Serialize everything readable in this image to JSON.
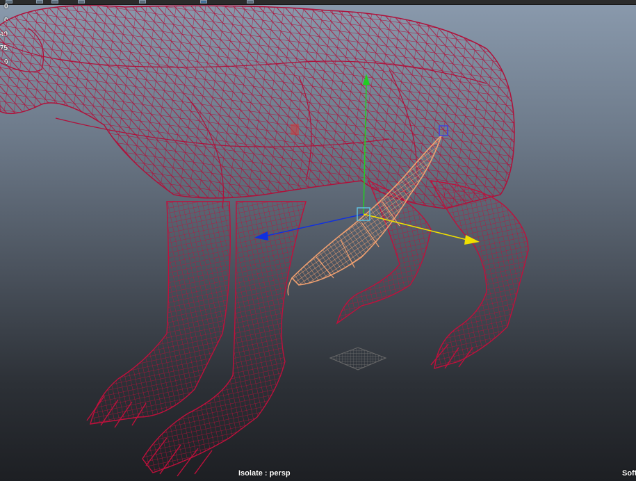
{
  "hud": {
    "stats": [
      "0",
      "0",
      "40",
      "75",
      "0"
    ],
    "panel_label": "Isolate : persp",
    "corner_label": "Soft"
  },
  "toolbar": {
    "icons": [
      "view-icon",
      "camera-icon",
      "grid-icon",
      "wireframe-icon",
      "shaded-icon",
      "isolate-icon",
      "layout-icon"
    ]
  },
  "colors": {
    "wireframe": "#b0103a",
    "selected_mesh": "#f0a070",
    "gizmo_x": "#f0e000",
    "gizmo_y": "#20d020",
    "gizmo_z": "#1030e0",
    "gizmo_center": "#60c0e0"
  }
}
